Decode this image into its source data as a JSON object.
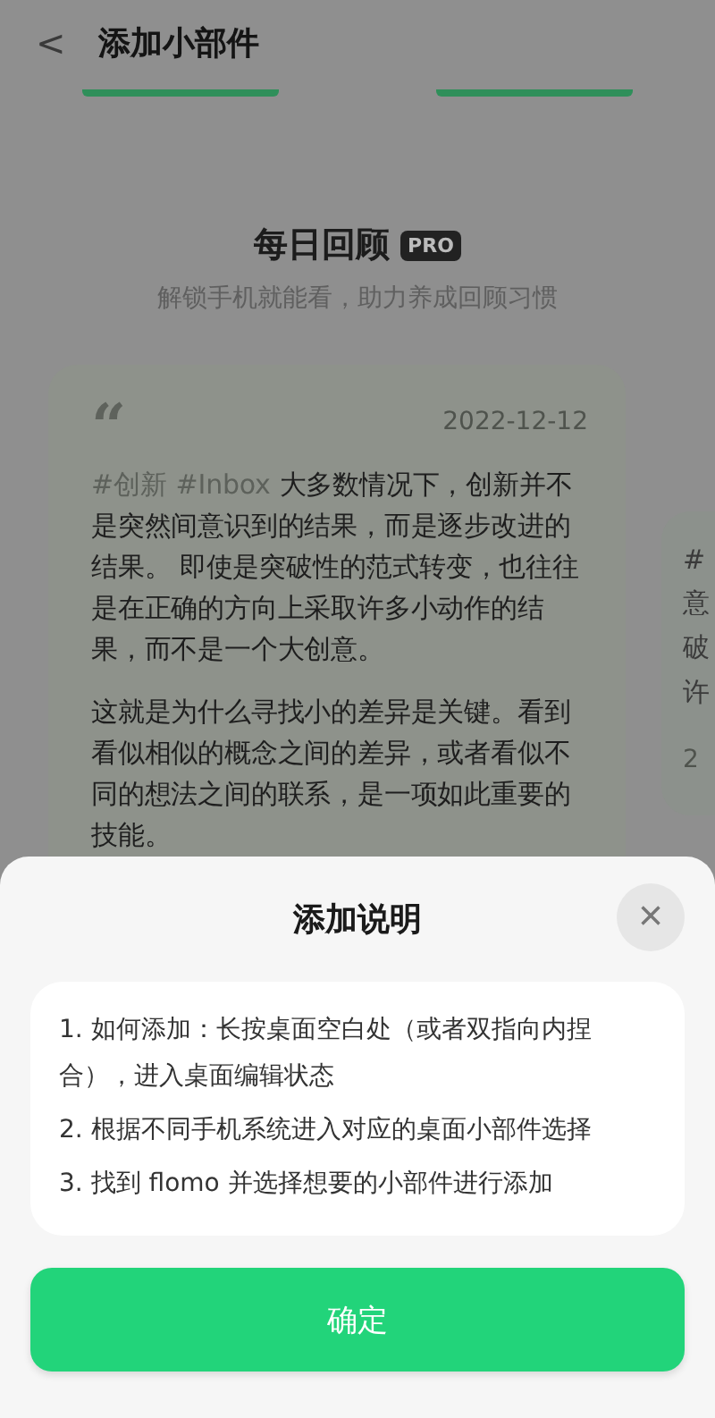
{
  "header": {
    "back": "<",
    "title": "添加小部件"
  },
  "tab_indicators": [
    {
      "selected": true
    },
    {
      "selected": true
    }
  ],
  "widget": {
    "title": "每日回顾",
    "badge": "PRO",
    "subtitle": "解锁手机就能看，助力养成回顾习惯",
    "card": {
      "quote": "“",
      "date": "2022-12-12",
      "tags": [
        "#创新",
        "#Inbox"
      ],
      "paragraphs": [
        "大多数情况下，创新并不是突然间意识到的结果，而是逐步改进的结果。 即使是突破性的范式转变，也往往是在正确的方向上采取许多小动作的结果，而不是一个大创意。",
        "这就是为什么寻找小的差异是关键。看到看似相似的概念之间的差异，或者看似不同的想法之间的联系，是一项如此重要的技能。"
      ]
    },
    "next_card": {
      "lines": [
        "#",
        "意",
        "破",
        "许"
      ],
      "date": "2"
    }
  },
  "sheet": {
    "title": "添加说明",
    "close": "×",
    "steps": [
      "1. 如何添加：长按桌面空白处（或者双指向内捏合），进入桌面编辑状态",
      "2. 根据不同手机系统进入对应的桌面小部件选择",
      "3. 找到 flomo 并选择想要的小部件进行添加"
    ],
    "confirm": "确定"
  }
}
